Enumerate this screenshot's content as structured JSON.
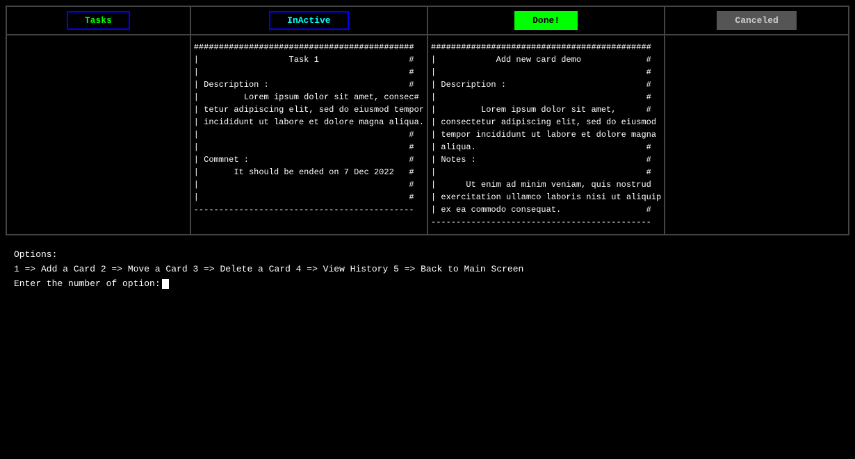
{
  "board": {
    "columns": [
      {
        "id": "tasks",
        "header_label": "Tasks",
        "header_class": "btn-tasks",
        "body": "                                                \n\n\n\n\n\n\n\n\n\n\n\n\n\n"
      },
      {
        "id": "inactive",
        "header_label": "InActive",
        "header_class": "btn-inactive",
        "body": "############################################\n|                  Task 1                  #\n|                                          #\n| Description :                            #\n|         Lorem ipsum dolor sit amet, consec#\n| tetur adipiscing elit, sed do eiusmod tempor#\n| incididunt ut labore et dolore magna aliqua.#\n|                                          #\n|                                          #\n| Commnet :                                #\n|       It should be ended on 7 Dec 2022   #\n|                                          #\n|                                          #\n--------------------------------------------"
      },
      {
        "id": "done",
        "header_label": "Done!",
        "header_class": "btn-done",
        "body": "############################################\n|            Add new card demo             #\n|                                          #\n| Description :                            #\n|                                          #\n|         Lorem ipsum dolor sit amet,      #\n| consectetur adipiscing elit, sed do eiusmod#\n| tempor incididunt ut labore et dolore magna#\n| aliqua.                                  #\n| Notes :                                  #\n|                                          #\n|      Ut enim ad minim veniam, quis nostrud#\n| exercitation ullamco laboris nisi ut aliquip#\n| ex ea commodo consequat.                 #\n--------------------------------------------"
      },
      {
        "id": "canceled",
        "header_label": "Canceled",
        "header_class": "btn-canceled",
        "body": ""
      }
    ]
  },
  "options": {
    "title": "Options:",
    "items": "  1 => Add a Card  2 => Move a Card  3 => Delete a Card  4 => View History  5 => Back to Main Screen"
  },
  "prompt": {
    "label": "Enter the number of option: "
  }
}
